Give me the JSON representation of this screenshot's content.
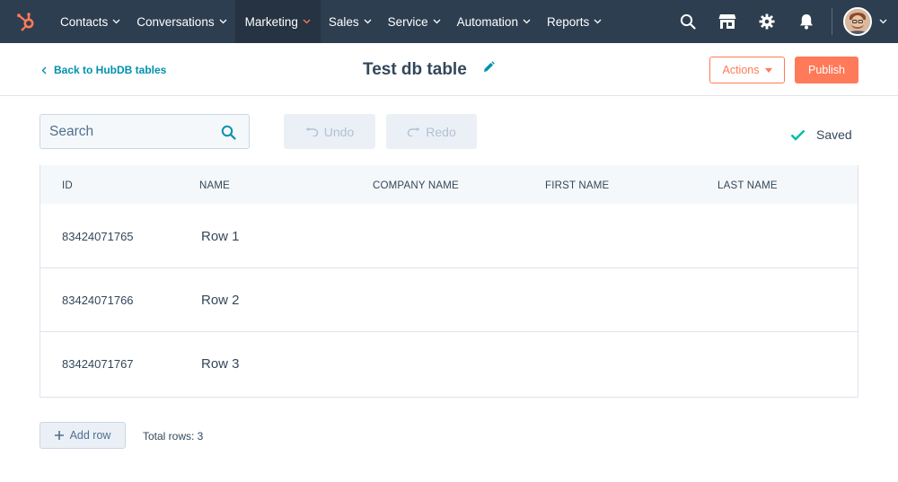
{
  "nav": {
    "items": [
      {
        "label": "Contacts"
      },
      {
        "label": "Conversations"
      },
      {
        "label": "Marketing"
      },
      {
        "label": "Sales"
      },
      {
        "label": "Service"
      },
      {
        "label": "Automation"
      },
      {
        "label": "Reports"
      }
    ],
    "active": "Marketing",
    "icons": [
      "search-icon",
      "marketplace-icon",
      "settings-icon",
      "notifications-icon"
    ]
  },
  "header": {
    "back_label": "Back to HubDB tables",
    "title": "Test db table",
    "actions_label": "Actions",
    "publish_label": "Publish"
  },
  "toolbar": {
    "search_placeholder": "Search",
    "undo_label": "Undo",
    "redo_label": "Redo",
    "saved_label": "Saved"
  },
  "table": {
    "columns": [
      "ID",
      "NAME",
      "COMPANY NAME",
      "FIRST NAME",
      "LAST NAME"
    ],
    "rows": [
      {
        "id": "83424071765",
        "name": "Row 1",
        "company_name": "",
        "first_name": "",
        "last_name": ""
      },
      {
        "id": "83424071766",
        "name": "Row 2",
        "company_name": "",
        "first_name": "",
        "last_name": ""
      },
      {
        "id": "83424071767",
        "name": "Row 3",
        "company_name": "",
        "first_name": "",
        "last_name": ""
      }
    ]
  },
  "footer": {
    "add_row_label": "Add row",
    "total_rows_label": "Total rows: 3"
  },
  "colors": {
    "nav_bg": "#2d3e50",
    "accent_orange": "#ff7a59",
    "link_teal": "#0091ae",
    "saved_check": "#00bda5"
  }
}
